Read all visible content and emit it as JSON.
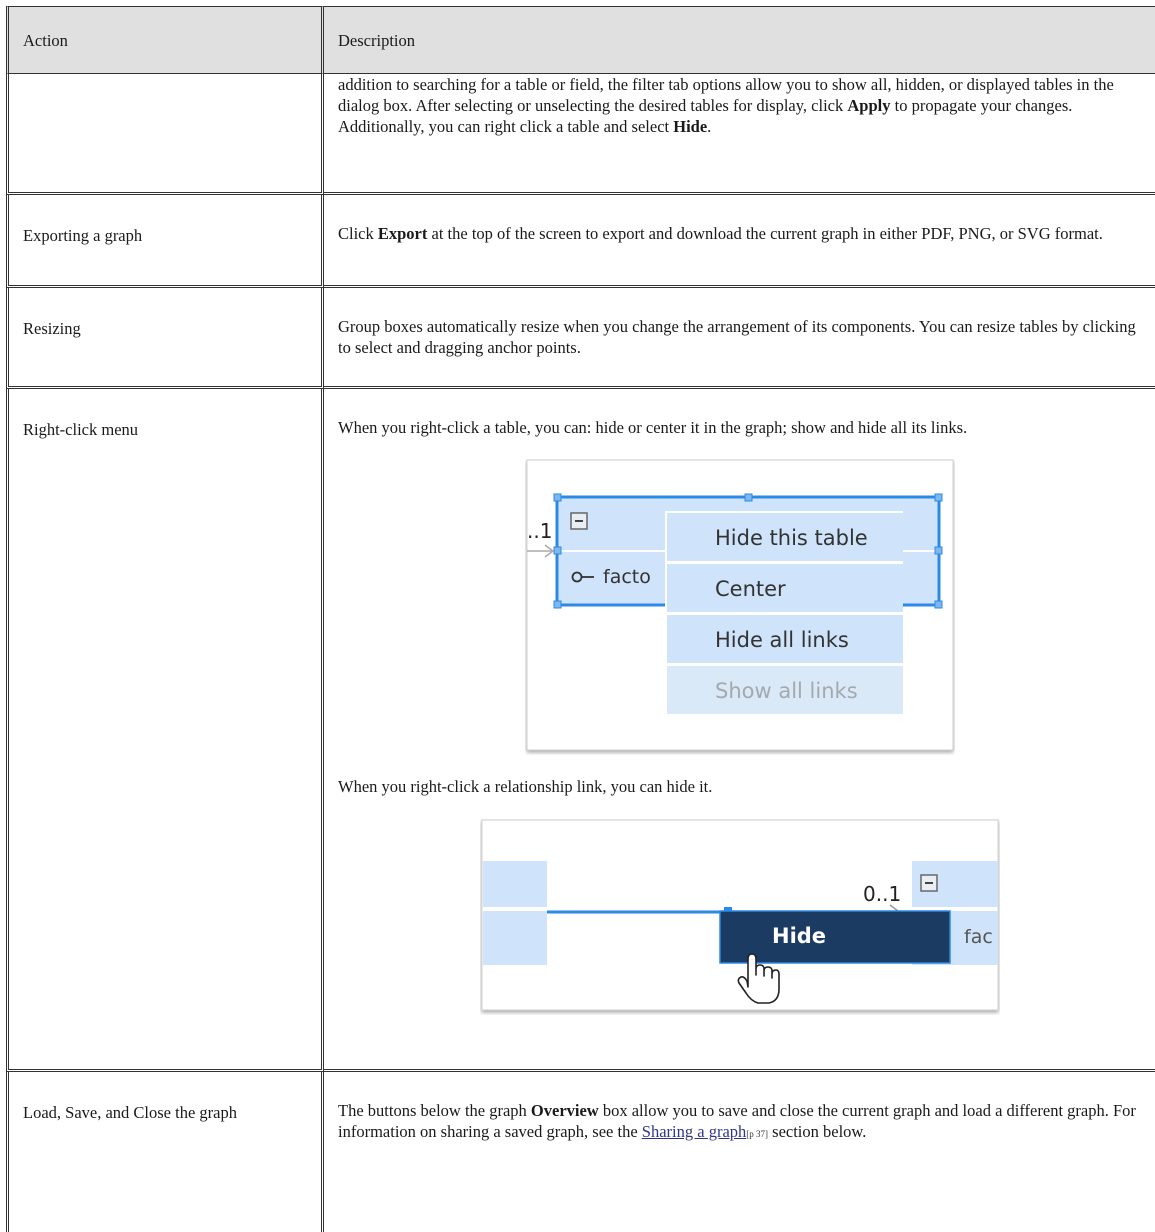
{
  "header": {
    "action": "Action",
    "description": "Description"
  },
  "rows": [
    {
      "action": "",
      "desc_a": "addition to searching for a table or field, the filter tab options allow you to show all, hidden, or displayed tables in the dialog box. After selecting or unselecting the desired tables for display, click ",
      "desc_b": "Apply",
      "desc_c": " to propagate your changes. Additionally, you can right click a table and select ",
      "desc_d": "Hide",
      "desc_e": "."
    },
    {
      "action": "Exporting a graph",
      "desc_a": "Click ",
      "desc_b": "Export",
      "desc_c": " at the top of the screen to export and download the current graph in either PDF, PNG, or SVG format."
    },
    {
      "action": "Resizing",
      "desc_a": "Group boxes automatically resize when you change the arrangement of its components. You can resize tables by clicking to select and dragging anchor points."
    },
    {
      "action": "Right-click menu",
      "desc_a": "When you right-click a table, you can: hide or center it in the graph; show and hide all its links.",
      "desc_b": "When you right-click a relationship link, you can hide it."
    },
    {
      "action": "Load, Save, and Close the graph",
      "desc_a": "The buttons below the graph ",
      "desc_b": "Overview",
      "desc_c": " box allow you to save and close the current graph and load a different graph. For information on sharing a saved graph, see the ",
      "link": "Sharing a graph",
      "pref": "[p 37]",
      "desc_d": " section below."
    }
  ],
  "figure1": {
    "multiplicity": "..1",
    "field_text": "facto",
    "menu": [
      "Hide this table",
      "Center",
      "Hide all links",
      "Show all links"
    ]
  },
  "figure2": {
    "multiplicity": "0..1",
    "menu": [
      "Hide"
    ],
    "field_text": "fac"
  },
  "colors": {
    "table_fill": "#cfe4fa",
    "selection": "#2b8ae6",
    "menu_fill": "#cfe4fa",
    "menu_dark": "#1c3b63",
    "header_bg": "#e0e0e0"
  }
}
